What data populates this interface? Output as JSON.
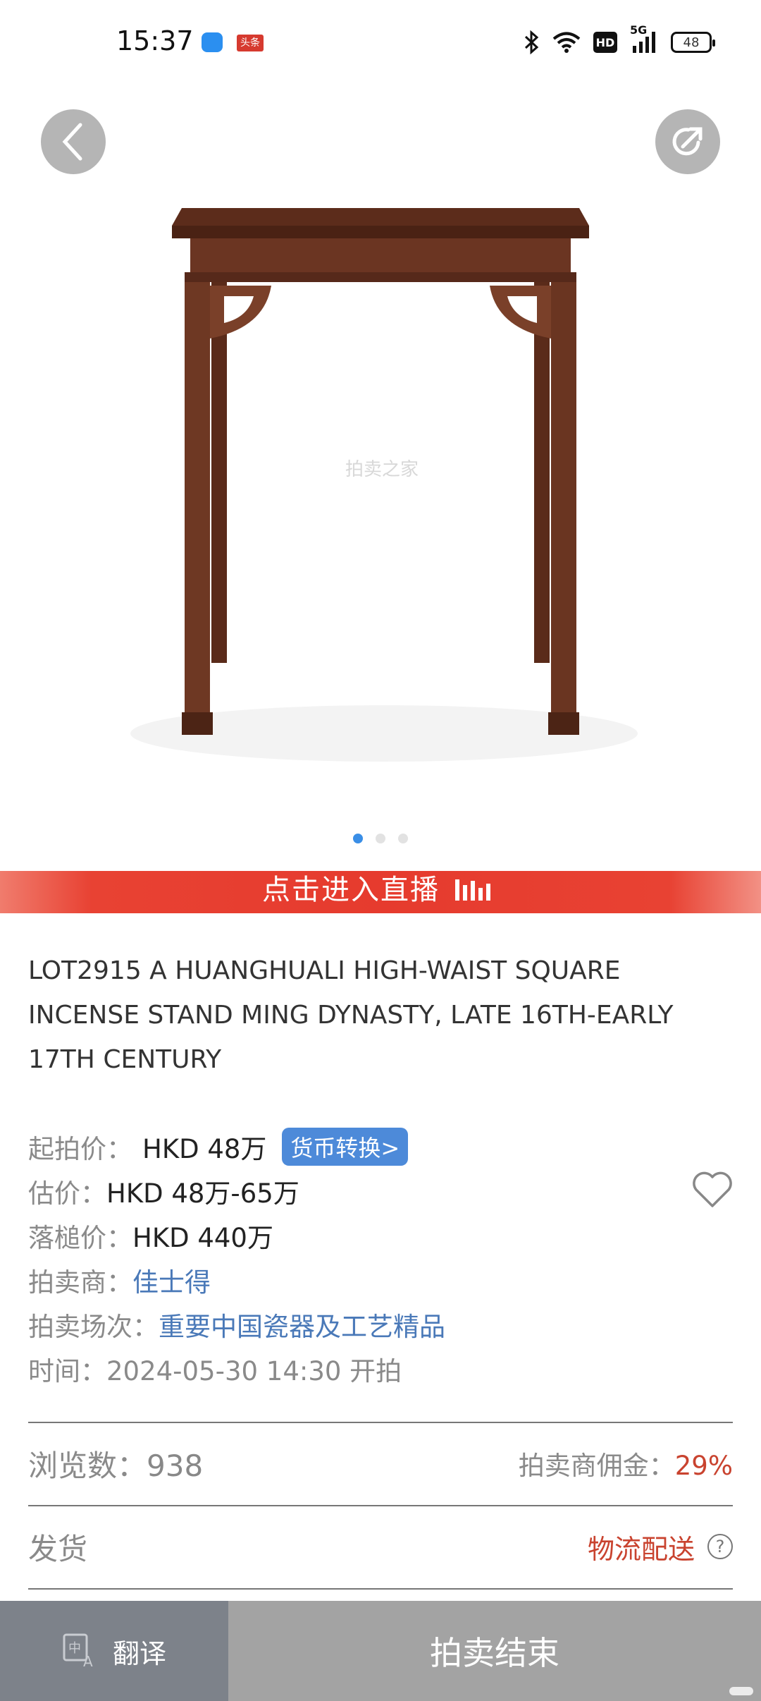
{
  "status_bar": {
    "time": "15:37",
    "app_badge": "头条",
    "network": "5G",
    "hd": "HD",
    "battery": "48"
  },
  "gallery": {
    "watermark": "拍卖之家",
    "page_count": 3,
    "active_index": 0
  },
  "live_banner": {
    "text": "点击进入直播"
  },
  "lot": {
    "title": "LOT2915 A HUANGHUALI HIGH-WAIST SQUARE INCENSE STAND MING DYNASTY, LATE 16TH-EARLY 17TH CENTURY",
    "starting_price_label": "起拍价：",
    "starting_price": "HKD 48万",
    "currency_button": "货币转换>",
    "estimate_label": "估价：",
    "estimate": "HKD 48万-65万",
    "hammer_label": "落槌价：",
    "hammer": "HKD 440万",
    "auctioneer_label": "拍卖商：",
    "auctioneer": "佳士得",
    "session_label": "拍卖场次：",
    "session": "重要中国瓷器及工艺精品",
    "time_label": "时间：",
    "time": "2024-05-30 14:30 开拍"
  },
  "stats": {
    "views_label": "浏览数：",
    "views": "938",
    "commission_label": "拍卖商佣金：",
    "commission": "29%"
  },
  "shipping": {
    "label": "发货",
    "value": "物流配送",
    "help": "?"
  },
  "bottom_bar": {
    "translate": "翻译",
    "status": "拍卖结束"
  }
}
